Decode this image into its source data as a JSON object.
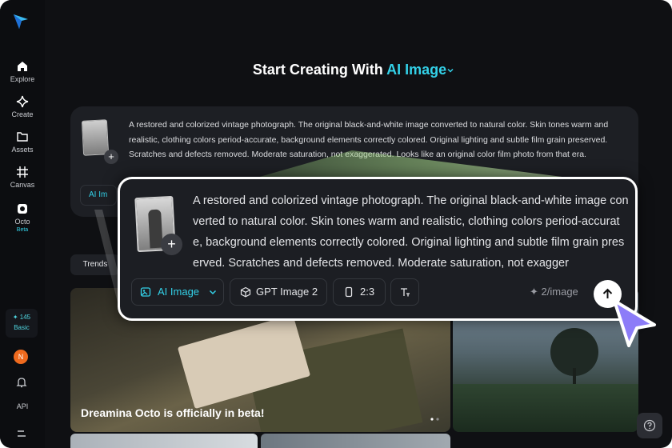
{
  "sidebar": {
    "items": [
      {
        "label": "Explore",
        "icon": "home-icon"
      },
      {
        "label": "Create",
        "icon": "sparkle-icon"
      },
      {
        "label": "Assets",
        "icon": "folder-icon"
      },
      {
        "label": "Canvas",
        "icon": "canvas-icon"
      },
      {
        "label": "Octo",
        "icon": "octo-icon",
        "badge": "Beta"
      }
    ],
    "credits": {
      "amount": "✦ 145",
      "plan": "Basic"
    },
    "avatar_initial": "N",
    "api_label": "API"
  },
  "header": {
    "title_prefix": "Start Creating With",
    "title_accent": "AI Image"
  },
  "prompt_card": {
    "text": "A restored and colorized vintage photograph. The original black-and-white image converted to natural color. Skin tones warm and realistic, clothing colors period-accurate, background elements correctly colored. Original lighting and subtle film grain preserved. Scratches and defects removed. Moderate saturation, not exaggerated. Looks like an original color film photo from that era.",
    "chip_label": "AI Im"
  },
  "focus_card": {
    "text": "A restored and colorized vintage photograph. The original black-and-white image converted to natural color. Skin tones warm and realistic, clothing colors period-accurate, background elements correctly colored. Original lighting and subtle film grain preserved. Scratches and defects removed. Moderate saturation, not exagger",
    "mode_label": "AI Image",
    "model_label": "GPT Image 2",
    "ratio_label": "2:3",
    "cost_label": "2/image"
  },
  "tabs": {
    "trends": "Trends"
  },
  "gallery": {
    "caption": "Dreamina Octo is officially in beta!"
  },
  "colors": {
    "accent": "#33d1e8",
    "background": "#0f1013",
    "card": "#1d1f24"
  }
}
